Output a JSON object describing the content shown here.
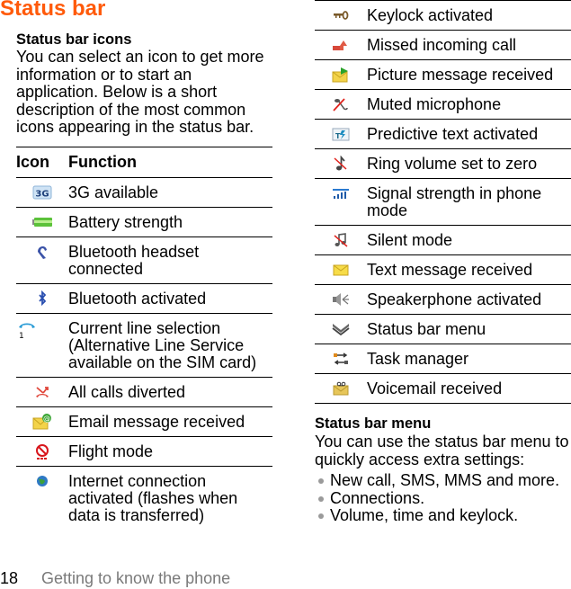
{
  "page": {
    "title": "Status bar",
    "number": "18",
    "section_title": "Getting to know the phone"
  },
  "intro": {
    "heading": "Status bar icons",
    "text": "You can select an icon to get more information or to start an application. Below is a short description of the most common icons appearing in the status bar."
  },
  "table": {
    "headers": {
      "icon": "Icon",
      "function": "Function"
    },
    "left_rows": [
      {
        "icon": "3g-icon",
        "function": "3G available"
      },
      {
        "icon": "battery-icon",
        "function": "Battery strength"
      },
      {
        "icon": "bluetooth-headset-icon",
        "function": "Bluetooth headset connected"
      },
      {
        "icon": "bluetooth-icon",
        "function": "Bluetooth activated"
      },
      {
        "icon": "line-selection-icon",
        "function": "Current line selection (Alternative Line Service available on the SIM card)"
      },
      {
        "icon": "calls-diverted-icon",
        "function": "All calls diverted"
      },
      {
        "icon": "email-icon",
        "function": "Email message received"
      },
      {
        "icon": "flight-mode-icon",
        "function": "Flight mode"
      },
      {
        "icon": "internet-icon",
        "function": "Internet connection activated (flashes when data is transferred)"
      }
    ],
    "right_rows": [
      {
        "icon": "keylock-icon",
        "function": "Keylock activated"
      },
      {
        "icon": "missed-call-icon",
        "function": "Missed incoming call"
      },
      {
        "icon": "picture-message-icon",
        "function": "Picture message received"
      },
      {
        "icon": "muted-microphone-icon",
        "function": "Muted microphone"
      },
      {
        "icon": "predictive-text-icon",
        "function": "Predictive text activated"
      },
      {
        "icon": "ring-volume-zero-icon",
        "function": "Ring volume set to zero"
      },
      {
        "icon": "signal-strength-icon",
        "function": "Signal strength in phone mode"
      },
      {
        "icon": "silent-mode-icon",
        "function": "Silent mode"
      },
      {
        "icon": "text-message-icon",
        "function": "Text message received"
      },
      {
        "icon": "speakerphone-icon",
        "function": "Speakerphone activated"
      },
      {
        "icon": "status-bar-menu-icon",
        "function": "Status bar menu"
      },
      {
        "icon": "task-manager-icon",
        "function": "Task manager"
      },
      {
        "icon": "voicemail-icon",
        "function": "Voicemail received"
      }
    ]
  },
  "menu_section": {
    "heading": "Status bar menu",
    "text": "You can use the status bar menu to quickly access extra settings:",
    "bullets": [
      "New call, SMS, MMS and more.",
      "Connections.",
      "Volume, time and keylock."
    ]
  },
  "colors": {
    "title": "#ff5a0a",
    "section_title": "#7a7a7a"
  }
}
